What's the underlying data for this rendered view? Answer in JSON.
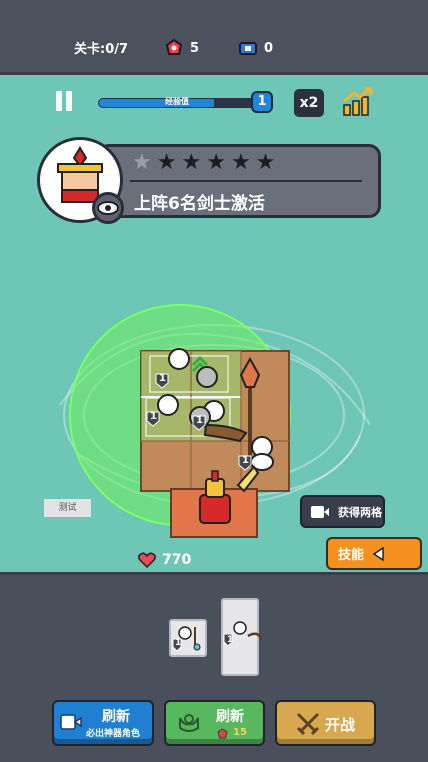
{
  "topbar": {
    "level_label": "关卡:0/7",
    "gems_value": "5",
    "tickets_value": "0"
  },
  "hud": {
    "exp_label": "经验值",
    "exp_fill_percent": 74,
    "level": "1",
    "speed_label": "x2"
  },
  "mission": {
    "stars_total": 6,
    "stars_lit": 5,
    "description": "上阵6名剑士激活"
  },
  "arena": {
    "test_label": "测试",
    "get_grid_label": "获得两格",
    "skill_label": "技能",
    "hp_value": "770",
    "unit_levels": [
      "1",
      "1",
      "1",
      "1"
    ]
  },
  "bench": {
    "card_levels": [
      "1",
      "1"
    ]
  },
  "actions": {
    "refresh_artifact_title": "刷新",
    "refresh_artifact_sub": "必出神器角色",
    "refresh_title": "刷新",
    "refresh_cost": "15",
    "start_battle": "开战"
  },
  "colors": {
    "arena_bg": "#6ec6b7",
    "skill_orange": "#f4911e",
    "refresh_blue": "#1f7fd1",
    "refresh_green": "#57b85e",
    "battle_gold": "#d7a850"
  }
}
